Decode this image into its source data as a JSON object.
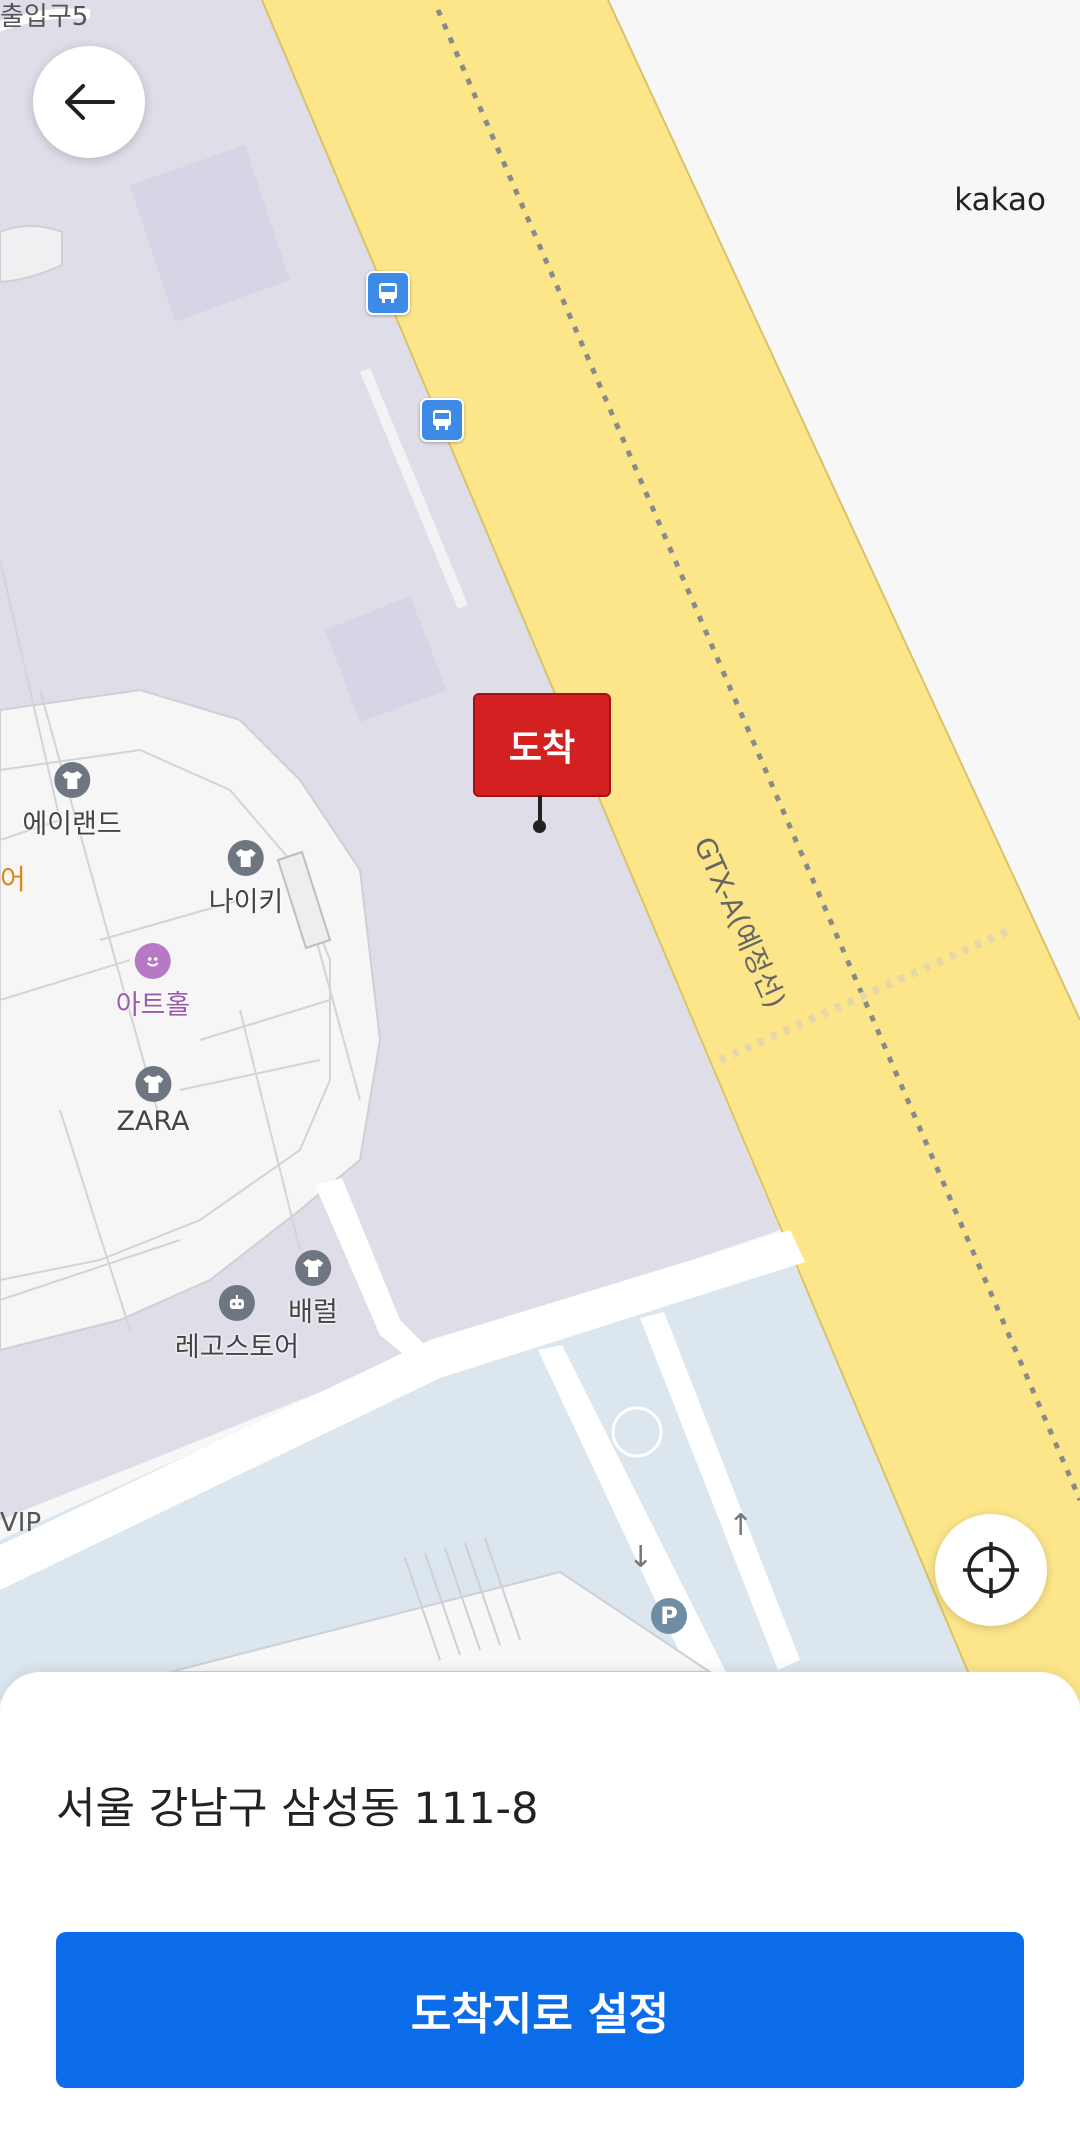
{
  "map": {
    "provider_label": "kakao",
    "top_left_label": "출입구5",
    "road_label": "GTX-A(예정선)",
    "edge_label_left": "어",
    "edge_label_vip": "VIP",
    "pois": [
      {
        "name": "에이랜드",
        "icon": "clothing-icon"
      },
      {
        "name": "나이키",
        "icon": "clothing-icon"
      },
      {
        "name": "아트홀",
        "icon": "art-hall-icon"
      },
      {
        "name": "ZARA",
        "icon": "clothing-icon"
      },
      {
        "name": "배럴",
        "icon": "clothing-icon"
      },
      {
        "name": "레고스토어",
        "icon": "toy-store-icon"
      }
    ],
    "parking_label": "P",
    "destination_pin_label": "도착"
  },
  "controls": {
    "back_icon": "arrow-left-icon",
    "locate_icon": "crosshair-icon"
  },
  "sheet": {
    "address": "서울 강남구 삼성동 111-8",
    "confirm_label": "도착지로 설정"
  },
  "colors": {
    "accent": "#0a6ce8",
    "pin": "#d32121",
    "road_yellow": "#fde68a",
    "plaza": "#dedde8",
    "water": "#dbe6ee"
  }
}
